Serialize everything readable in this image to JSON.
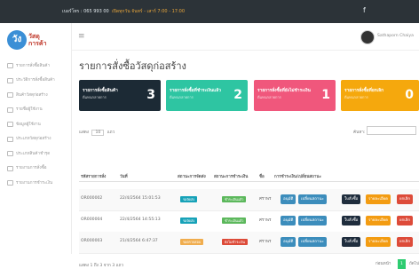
{
  "topbar": {
    "info_label": "เบอร์โทร :",
    "phone": "065 993 00",
    "hours_label": "เปิดทุกวัน",
    "hours": "จันทร์ - เสาร์ 7:00 - 17:00",
    "social_icon": "facebook-icon"
  },
  "logo": {
    "mark": "วัง",
    "line1": "วัสดุ",
    "line2": "การค้า"
  },
  "sidebar": {
    "items": [
      {
        "label": "รายการสั่งซื้อสินค้า"
      },
      {
        "label": "ประวัติการสั่งซื้อสินค้า"
      },
      {
        "label": "สินค้าวัสดุก่อสร้าง"
      },
      {
        "label": "รายชื่อผู้ใช้งาน"
      },
      {
        "label": "ข้อมูลผู้ใช้งาน"
      },
      {
        "label": "ประเภทวัสดุก่อสร้าง"
      },
      {
        "label": "ประเภทสินค้าชำรุด"
      },
      {
        "label": "รายงานการสั่งซื้อ"
      },
      {
        "label": "รายงานการชำระเงิน"
      }
    ]
  },
  "header": {
    "menu_icon": "hamburger-icon",
    "username": "Sathaporn Chaiya"
  },
  "page": {
    "title": "รายการสั่งซื้อวัสดุก่อสร้าง"
  },
  "cards": [
    {
      "label": "รายการสั่งซื้อสินค้า",
      "sub": "ดีแทนกลายการ",
      "value": "3",
      "color": "#1c2a35"
    },
    {
      "label": "รายการสั่งซื้อที่ชำระเงินแล้ว",
      "sub": "ดีแทนกลายการ",
      "value": "2",
      "color": "#2ec5a2"
    },
    {
      "label": "รายการสั่งซื้อที่ยังไม่ชำระเงิน",
      "sub": "ดีแทนกลายการ",
      "value": "1",
      "color": "#f0577c"
    },
    {
      "label": "รายการสั่งซื้อที่ยกเลิก",
      "sub": "ดีแทนกลายการ",
      "value": "0",
      "color": "#f5a80d"
    }
  ],
  "table_controls": {
    "length_prefix": "แสดง",
    "length_value": "10",
    "length_suffix": "แถว",
    "search_label": "ค้นหา:"
  },
  "table": {
    "columns": [
      "รหัสรายการสั่ง",
      "วันที่",
      "สถานะการจัดส่ง",
      "สถานะการชำระเงิน",
      "ชื่อ",
      "การชำระเงิน/เปลี่ยนสถานะ"
    ],
    "rows": [
      {
        "id": "OR000002",
        "date": "22/4/2564 15:01:53",
        "ship_status": "รอจัดส่ง",
        "pay_status": "ชำระเงินแล้ว",
        "name": "ศราพร",
        "btn_confirm": "อนุมัติ",
        "btn_change": "เปลี่ยนสถานะ",
        "btn_invoice": "ใบสั่งซื้อ",
        "btn_detail": "รายละเอียด",
        "btn_cancel": "ยกเลิก"
      },
      {
        "id": "OR000004",
        "date": "22/4/2564 14:55:13",
        "ship_status": "รอจัดส่ง",
        "pay_status": "ชำระเงินแล้ว",
        "name": "ศราพร",
        "btn_confirm": "อนุมัติ",
        "btn_change": "เปลี่ยนสถานะ",
        "btn_invoice": "ใบสั่งซื้อ",
        "btn_detail": "รายละเอียด",
        "btn_cancel": "ยกเลิก"
      },
      {
        "id": "OR000003",
        "date": "21/4/2564 6:47:37",
        "ship_status": "รอตรวจสอบ",
        "pay_status": "ยังไม่ชำระเงิน",
        "name": "ศราพร",
        "btn_confirm": "อนุมัติ",
        "btn_change": "เปลี่ยนสถานะ",
        "btn_invoice": "ใบสั่งซื้อ",
        "btn_detail": "รายละเอียด",
        "btn_cancel": "ยกเลิก"
      }
    ]
  },
  "footer": {
    "info": "แสดง 1 ถึง 3 จาก 3 แถว",
    "prev": "ก่อนหน้า",
    "page": "1",
    "next": "ถัดไป"
  }
}
